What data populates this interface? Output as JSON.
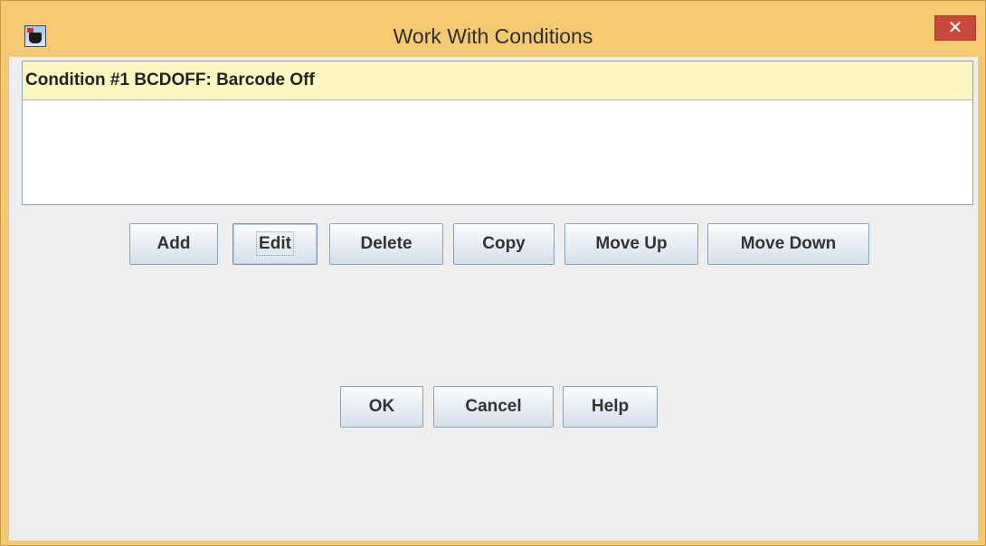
{
  "window": {
    "title": "Work With Conditions",
    "close_glyph": "✕"
  },
  "conditions": {
    "items": [
      {
        "label": "Condition #1 BCDOFF: Barcode Off",
        "selected": true
      }
    ]
  },
  "toolbar": {
    "add_label": "Add",
    "edit_label": "Edit",
    "delete_label": "Delete",
    "copy_label": "Copy",
    "move_up_label": "Move Up",
    "move_down_label": "Move Down"
  },
  "dialog": {
    "ok_label": "OK",
    "cancel_label": "Cancel",
    "help_label": "Help"
  },
  "colors": {
    "title_bar": "#f5c872",
    "close_button": "#c7483c",
    "selection": "#fdf8c2",
    "panel": "#eeeeee"
  }
}
